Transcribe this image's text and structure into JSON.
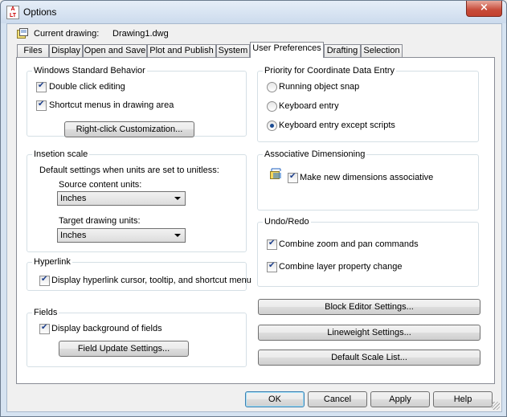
{
  "window": {
    "title": "Options",
    "close_symbol": "×"
  },
  "current_drawing": {
    "label": "Current drawing:",
    "value": "Drawing1.dwg"
  },
  "tabs": [
    {
      "label": "Files"
    },
    {
      "label": "Display"
    },
    {
      "label": "Open and Save"
    },
    {
      "label": "Plot and Publish"
    },
    {
      "label": "System"
    },
    {
      "label": "User Preferences"
    },
    {
      "label": "Drafting"
    },
    {
      "label": "Selection"
    }
  ],
  "windows_standard": {
    "title": "Windows Standard Behavior",
    "double_click": "Double click editing",
    "shortcut_menus": "Shortcut menus in drawing area",
    "right_click_btn": "Right-click Customization..."
  },
  "insertion_scale": {
    "title": "Insetion scale",
    "description": "Default settings when units are set to unitless:",
    "source_label": "Source content units:",
    "source_value": "Inches",
    "target_label": "Target drawing units:",
    "target_value": "Inches"
  },
  "hyperlink": {
    "title": "Hyperlink",
    "display": "Display hyperlink cursor, tooltip, and shortcut menu"
  },
  "fields": {
    "title": "Fields",
    "display_background": "Display background of fields",
    "update_btn": "Field Update Settings..."
  },
  "priority": {
    "title": "Priority for Coordinate Data Entry",
    "options": [
      "Running object snap",
      "Keyboard entry",
      "Keyboard entry except scripts"
    ],
    "selected_index": 2
  },
  "associative": {
    "title": "Associative Dimensioning",
    "make_new": "Make new dimensions associative"
  },
  "undo_redo": {
    "title": "Undo/Redo",
    "combine_zoom": "Combine zoom and pan commands",
    "combine_layer": "Combine layer property change"
  },
  "side_buttons": {
    "block_editor": "Block Editor Settings...",
    "lineweight": "Lineweight Settings...",
    "default_scale": "Default Scale List..."
  },
  "footer": {
    "ok": "OK",
    "cancel": "Cancel",
    "apply": "Apply",
    "help": "Help"
  },
  "colors": {
    "title_bar": "#ccdbed",
    "close_button": "#c74b39",
    "check_mark": "#1c3f8c",
    "radio_dot": "#1a4b92"
  }
}
